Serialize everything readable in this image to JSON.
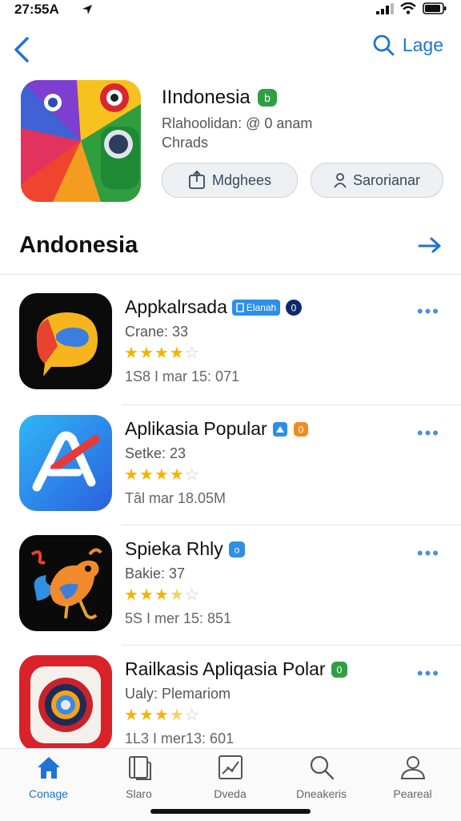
{
  "status_bar": {
    "time": "27:55A"
  },
  "nav": {
    "search_label": "Lage"
  },
  "hero": {
    "title": "IIndonesia",
    "subtitle_line1": "Rlahoolidan: @ 0 anam",
    "subtitle_line2": "Chrads",
    "buttons": [
      {
        "label": "Mdghees"
      },
      {
        "label": "Sarorianar"
      }
    ]
  },
  "section": {
    "title": "Andonesia"
  },
  "apps": [
    {
      "name": "Appkalrsada",
      "badge": "Elanah",
      "meta": "Crane: 33",
      "rating": 4,
      "size": "1S8 I mar 15: 071"
    },
    {
      "name": "Aplikasia Popular",
      "meta": "Setke: 23",
      "rating": 4,
      "size": "Tâl mar 18.05M"
    },
    {
      "name": "Spieka Rhly",
      "meta": "Bakie: 37",
      "rating": 3.5,
      "size": "5S I mer 15: 851"
    },
    {
      "name": "Railkasis Apliqasia Polar",
      "meta": "Ualy: Plemariom",
      "rating": 3.5,
      "size": "1L3 I mer13: 601"
    }
  ],
  "tabs": [
    {
      "label": "Conage",
      "icon": "home-icon",
      "active": true
    },
    {
      "label": "Slaro",
      "icon": "book-icon",
      "active": false
    },
    {
      "label": "Dveda",
      "icon": "chart-icon",
      "active": false
    },
    {
      "label": "Dneakeris",
      "icon": "search-icon",
      "active": false
    },
    {
      "label": "Peareal",
      "icon": "profile-icon",
      "active": false
    }
  ],
  "colors": {
    "accent": "#1f73d6",
    "star": "#f5b301"
  }
}
